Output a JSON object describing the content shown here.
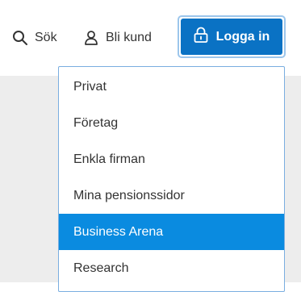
{
  "header": {
    "search_label": "Sök",
    "customer_label": "Bli kund",
    "login_label": "Logga in"
  },
  "icons": {
    "search": "search-icon",
    "customer": "user-icon",
    "login": "lock-icon"
  },
  "colors": {
    "primary": "#0a72c4",
    "active_item": "#0a8be0",
    "background_gray": "#ededed"
  },
  "dropdown": {
    "items": [
      {
        "label": "Privat",
        "active": false
      },
      {
        "label": "Företag",
        "active": false
      },
      {
        "label": "Enkla firman",
        "active": false
      },
      {
        "label": "Mina pensionssidor",
        "active": false
      },
      {
        "label": "Business Arena",
        "active": true
      },
      {
        "label": "Research",
        "active": false
      }
    ]
  }
}
